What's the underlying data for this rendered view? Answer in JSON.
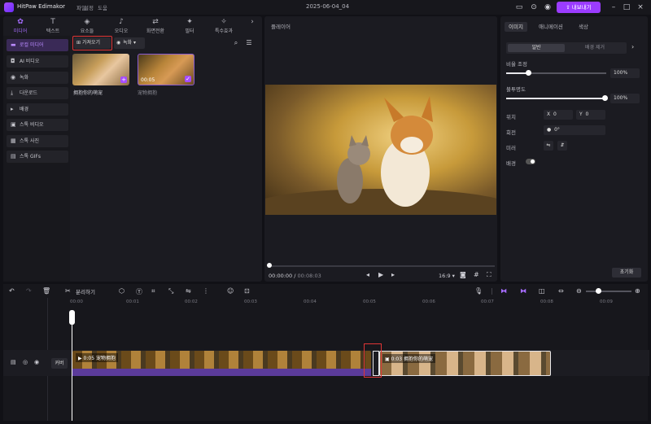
{
  "titlebar": {
    "app_name": "HitPaw Edimakor",
    "menu": [
      "파일",
      "설정",
      "도움"
    ],
    "project_title": "2025-06-04_04",
    "export_label": "내보내기"
  },
  "tabs": [
    {
      "label": "미디어",
      "icon": "media-icon"
    },
    {
      "label": "텍스트",
      "icon": "text-icon"
    },
    {
      "label": "요소들",
      "icon": "elements-icon"
    },
    {
      "label": "오디오",
      "icon": "audio-icon"
    },
    {
      "label": "화면전환",
      "icon": "transition-icon"
    },
    {
      "label": "필터",
      "icon": "filter-icon"
    },
    {
      "label": "특수효과",
      "icon": "effects-icon"
    }
  ],
  "sidebar": {
    "items": [
      {
        "label": "로컬 미디어",
        "icon": "folder-icon"
      },
      {
        "label": "AI 비디오",
        "icon": "ai-icon"
      },
      {
        "label": "녹화",
        "icon": "record-icon"
      },
      {
        "label": "다운로드",
        "icon": "download-icon"
      },
      {
        "label": "배경",
        "icon": "background-icon"
      },
      {
        "label": "스톡 비디오",
        "icon": "stock-video-icon"
      },
      {
        "label": "스톡 사진",
        "icon": "stock-photo-icon"
      },
      {
        "label": "스톡 GIFs",
        "icon": "gif-icon"
      }
    ]
  },
  "media": {
    "import_label": "가져오기",
    "record_label": "녹화",
    "items": [
      {
        "name": "拥抱你的萌宠",
        "duration": ""
      },
      {
        "name": "宠物拥抱",
        "duration": "00:05"
      }
    ]
  },
  "player": {
    "label": "플레이어",
    "current_time": "00:00:00",
    "total_time": "00:08:03",
    "ratio": "16:9"
  },
  "properties": {
    "tabs": [
      "이미지",
      "애니메이션",
      "색상"
    ],
    "segments": [
      "일반",
      "배경 제거"
    ],
    "scale_label": "비율 조정",
    "scale_value": "100%",
    "opacity_label": "불투명도",
    "opacity_value": "100%",
    "position_label": "위치",
    "x_label": "X",
    "x_value": "0",
    "y_label": "Y",
    "y_value": "0",
    "rotation_label": "회전",
    "rotation_value": "0°",
    "mirror_label": "미러",
    "background_label": "배경",
    "reset_label": "초기화"
  },
  "timeline": {
    "split_label": "분리하기",
    "cover_label": "커버",
    "ticks": [
      "00:00",
      "00:01",
      "00:02",
      "00:03",
      "00:04",
      "00:05",
      "00:06",
      "00:07",
      "00:08",
      "00:09"
    ],
    "clips": [
      {
        "duration": "0:05",
        "name": "宠物拥抱"
      },
      {
        "duration": "0:03",
        "name": "拥抱你的萌宠"
      }
    ]
  },
  "colors": {
    "accent": "#9b3cff",
    "highlight_box": "#e03535"
  }
}
